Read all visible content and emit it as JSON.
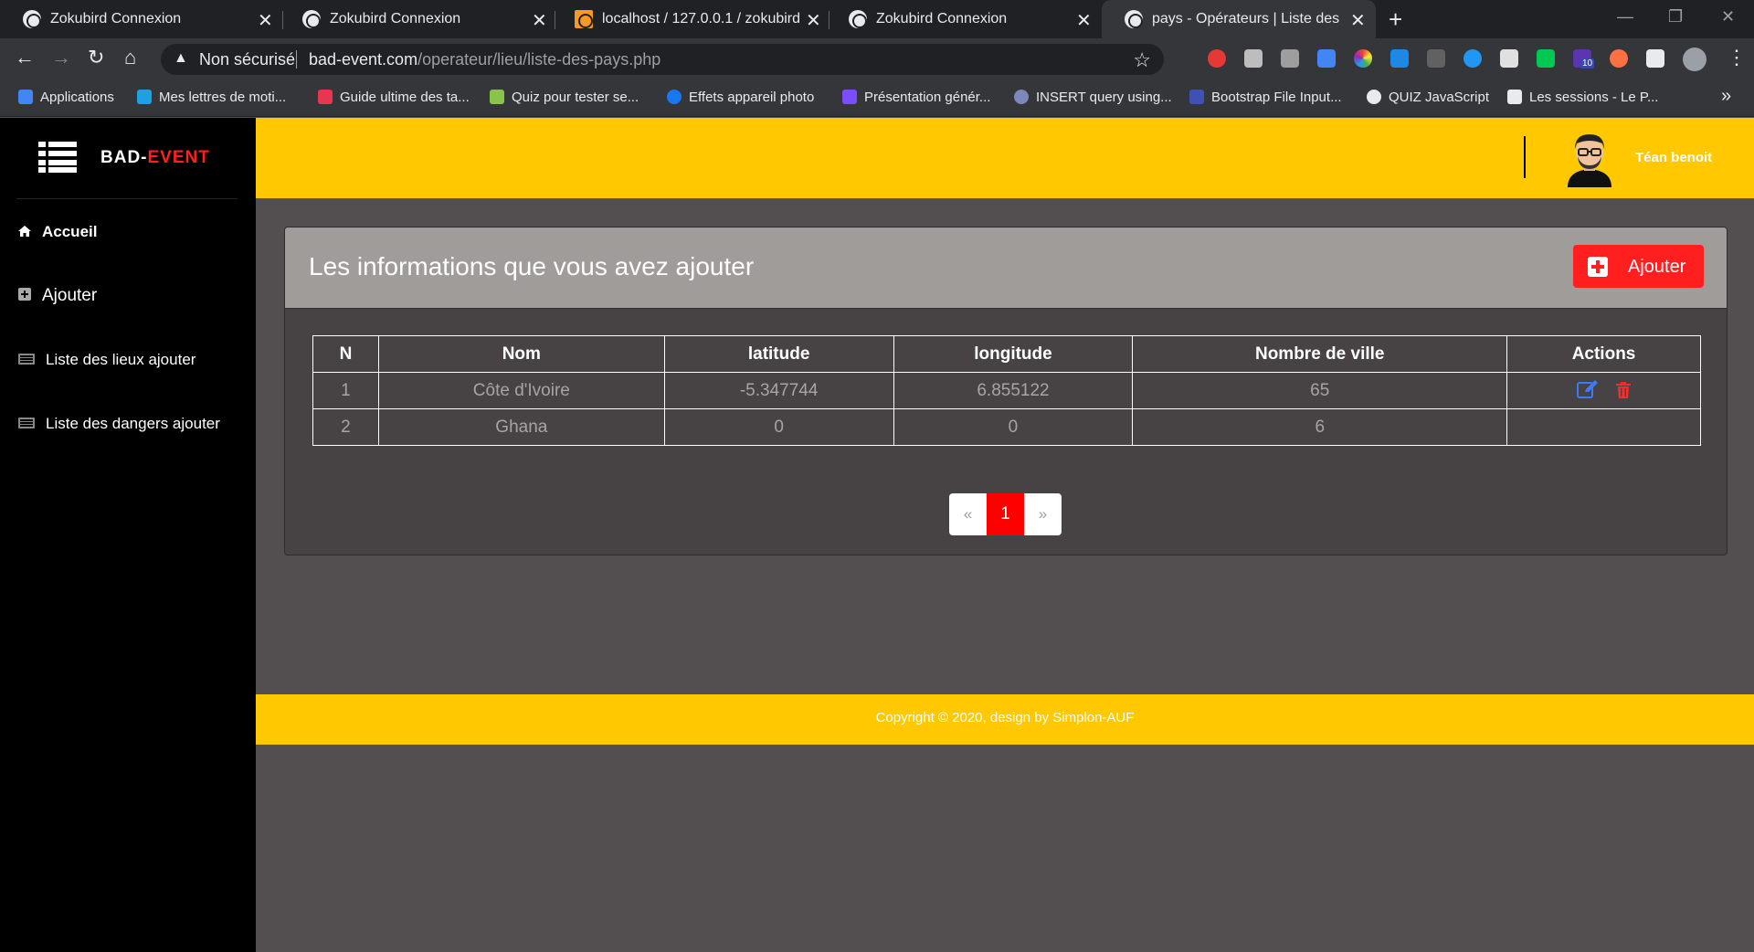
{
  "browser": {
    "tabs": [
      {
        "title": "Zokubird Connexion",
        "active": false
      },
      {
        "title": "Zokubird Connexion",
        "active": false
      },
      {
        "title": "localhost / 127.0.0.1 / zokubird /",
        "active": false
      },
      {
        "title": "Zokubird Connexion",
        "active": false
      },
      {
        "title": "pays - Opérateurs | Liste des info",
        "active": true
      }
    ],
    "close_glyph": "✕",
    "new_tab_glyph": "+",
    "security_label": "Non sécurisé",
    "url_host": "bad-event.com",
    "url_path": "/operateur/lieu/liste-des-pays.php",
    "extension_badge": "10",
    "bookmarks": [
      {
        "label": "Applications",
        "icon": "apps-grid-icon",
        "color": "#4285f4"
      },
      {
        "label": "Mes lettres de moti...",
        "icon": "nj-icon",
        "color": "#1ea0e6"
      },
      {
        "label": "Guide ultime des ta...",
        "icon": "b-icon",
        "color": "#e8364f"
      },
      {
        "label": "Quiz pour tester se...",
        "icon": "quiz-icon",
        "color": "#8bc34a"
      },
      {
        "label": "Effets appareil photo",
        "icon": "facebook-icon",
        "color": "#1877f2"
      },
      {
        "label": "Présentation génér...",
        "icon": "d-icon",
        "color": "#7c4dff"
      },
      {
        "label": "INSERT query using...",
        "icon": "php-icon",
        "color": "#7b88b8"
      },
      {
        "label": "Bootstrap File Input...",
        "icon": "mdb-icon",
        "color": "#3f51b5"
      },
      {
        "label": "QUIZ JavaScript",
        "icon": "globe-icon",
        "color": "#e8eaed"
      },
      {
        "label": "Les sessions - Le P...",
        "icon": "check-icon",
        "color": "#e8eaed"
      }
    ],
    "bookmarks_more": "»"
  },
  "sidebar": {
    "brand_main": "BAD-",
    "brand_accent": "EVENT",
    "items": [
      {
        "label": "Accueil",
        "icon": "home-icon"
      },
      {
        "label": "Ajouter",
        "icon": "plus-square-icon"
      },
      {
        "label": "Liste des lieux ajouter",
        "icon": "list-icon"
      },
      {
        "label": "Liste des dangers ajouter",
        "icon": "list-icon"
      }
    ]
  },
  "header": {
    "user_name": "Téan benoit"
  },
  "card": {
    "title": "Les informations que vous avez ajouter",
    "add_label": "Ajouter"
  },
  "table": {
    "headers": [
      "N",
      "Nom",
      "latitude",
      "longitude",
      "Nombre de ville",
      "Actions"
    ],
    "rows": [
      {
        "n": "1",
        "nom": "Côte d'Ivoire",
        "latitude": "-5.347744",
        "longitude": "6.855122",
        "villes": "65",
        "has_actions": true
      },
      {
        "n": "2",
        "nom": "Ghana",
        "latitude": "0",
        "longitude": "0",
        "villes": "6",
        "has_actions": false
      }
    ]
  },
  "pagination": {
    "prev": "«",
    "current": "1",
    "next": "»"
  },
  "footer": {
    "text": "Copyright © 2020, design by Simplon-AUF"
  },
  "colors": {
    "accent_yellow": "#ffc800",
    "accent_red": "#ff1f1f",
    "page_bg": "#534f50",
    "sidebar_bg": "#000000"
  }
}
